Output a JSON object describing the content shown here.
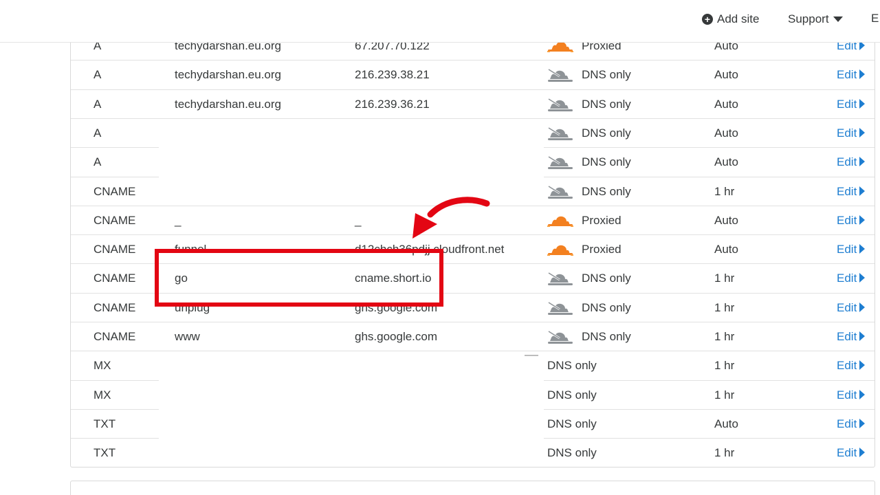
{
  "topnav": {
    "add_site": "Add site",
    "support": "Support",
    "extra": "E"
  },
  "colors": {
    "proxied_cloud": "#f38020",
    "dns_only_cloud": "#8e9397",
    "edit_link": "#1e7ed1",
    "highlight": "#e30613"
  },
  "records": [
    {
      "type": "A",
      "name": "techydarshan.eu.org",
      "content": "67.207.70.122",
      "icon": "proxied-cloud",
      "status": "Proxied",
      "ttl": "Auto",
      "edit": "Edit"
    },
    {
      "type": "A",
      "name": "techydarshan.eu.org",
      "content": "216.239.38.21",
      "icon": "dns-only-cloud",
      "status": "DNS only",
      "ttl": "Auto",
      "edit": "Edit"
    },
    {
      "type": "A",
      "name": "techydarshan.eu.org",
      "content": "216.239.36.21",
      "icon": "dns-only-cloud",
      "status": "DNS only",
      "ttl": "Auto",
      "edit": "Edit"
    },
    {
      "type": "A",
      "name": "",
      "content": "",
      "icon": "dns-only-cloud",
      "status": "DNS only",
      "ttl": "Auto",
      "edit": "Edit"
    },
    {
      "type": "A",
      "name": "",
      "content": "",
      "icon": "dns-only-cloud",
      "status": "DNS only",
      "ttl": "Auto",
      "edit": "Edit"
    },
    {
      "type": "CNAME",
      "name": "",
      "content": "",
      "icon": "dns-only-cloud",
      "status": "DNS only",
      "ttl": "1 hr",
      "edit": "Edit"
    },
    {
      "type": "CNAME",
      "name": "_",
      "content": "_",
      "icon": "proxied-cloud",
      "status": "Proxied",
      "ttl": "Auto",
      "edit": "Edit"
    },
    {
      "type": "CNAME",
      "name": "funnel",
      "content": "d12chch36pdjj.cloudfront.net",
      "icon": "proxied-cloud",
      "status": "Proxied",
      "ttl": "Auto",
      "edit": "Edit"
    },
    {
      "type": "CNAME",
      "name": "go",
      "content": "cname.short.io",
      "icon": "dns-only-cloud",
      "status": "DNS only",
      "ttl": "1 hr",
      "edit": "Edit"
    },
    {
      "type": "CNAME",
      "name": "unplug",
      "content": "ghs.google.com",
      "icon": "dns-only-cloud",
      "status": "DNS only",
      "ttl": "1 hr",
      "edit": "Edit"
    },
    {
      "type": "CNAME",
      "name": "www",
      "content": "ghs.google.com",
      "icon": "dns-only-cloud",
      "status": "DNS only",
      "ttl": "1 hr",
      "edit": "Edit"
    },
    {
      "type": "MX",
      "name": "",
      "content": "",
      "icon": "none",
      "status": "DNS only",
      "ttl": "1 hr",
      "edit": "Edit"
    },
    {
      "type": "MX",
      "name": "",
      "content": "",
      "icon": "none",
      "status": "DNS only",
      "ttl": "1 hr",
      "edit": "Edit"
    },
    {
      "type": "TXT",
      "name": "",
      "content": "",
      "icon": "none",
      "status": "DNS only",
      "ttl": "Auto",
      "edit": "Edit"
    },
    {
      "type": "TXT",
      "name": "",
      "content": "",
      "icon": "none",
      "status": "DNS only",
      "ttl": "1 hr",
      "edit": "Edit"
    }
  ]
}
